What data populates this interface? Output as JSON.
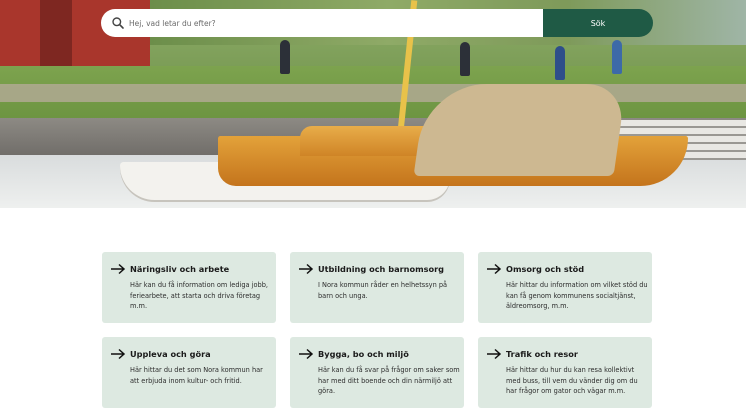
{
  "search": {
    "placeholder": "Hej, vad letar du efter?",
    "button_label": "Sök"
  },
  "cards": [
    {
      "title": "Näringsliv och arbete",
      "description": "Här kan du få information om lediga jobb, feriearbete, att starta och driva företag m.m."
    },
    {
      "title": "Utbildning och barnomsorg",
      "description": "I Nora kommun råder en helhetssyn på barn och unga."
    },
    {
      "title": "Omsorg och stöd",
      "description": "Här hittar du information om vilket stöd du kan få genom kommunens socialtjänst, äldreomsorg, m.m."
    },
    {
      "title": "Uppleva och göra",
      "description": "Här hittar du det som Nora kommun har att erbjuda inom kultur- och fritid."
    },
    {
      "title": "Bygga, bo och miljö",
      "description": "Här kan du få svar på frågor om saker som har med ditt boende och din närmiljö att göra."
    },
    {
      "title": "Trafik och resor",
      "description": "Här hittar du hur du kan resa kollektivt med buss, till vem du vänder dig om du har frågor om gator och vägar m.m."
    }
  ],
  "icons": {
    "search": "search-icon",
    "card_arrow": "arrow-right-icon"
  },
  "colors": {
    "button": "#1f5a45",
    "card_background": "#dde9e1"
  }
}
